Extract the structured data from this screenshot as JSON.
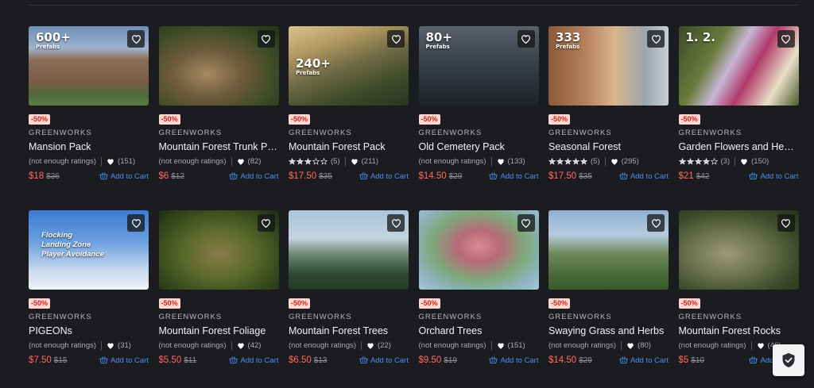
{
  "colors": {
    "background": "#1b1c20",
    "discount_bg": "#ffd8d4",
    "discount_text": "#c8261a",
    "sale_price": "#ff6b5e",
    "link": "#4a8ff3"
  },
  "products": [
    {
      "discount": "-50%",
      "publisher": "GREENWORKS",
      "title": "Mansion Pack",
      "rating_text": "(not enough ratings)",
      "stars": 0,
      "favorites": "(151)",
      "price": "$18",
      "old_price": "$36",
      "cart_label": "Add to Cart",
      "overlay_big": "600+",
      "overlay_small": "Prefabs",
      "thumb_bg": "linear-gradient(180deg,#6e8fb8 0%,#9fb3cf 28%,#8a6e58 42%,#7a5c47 70%,#4f6a3c 86%,#5c7a45 100%)"
    },
    {
      "discount": "-50%",
      "publisher": "GREENWORKS",
      "title": "Mountain Forest Trunk Pack",
      "rating_text": "(not enough ratings)",
      "stars": 0,
      "favorites": "(82)",
      "price": "$6",
      "old_price": "$12",
      "cart_label": "Add to Cart",
      "overlay_big": "",
      "overlay_small": "",
      "thumb_bg": "radial-gradient(ellipse at 40% 60%,#a58a63 0%,#6e5a3b 35%,#3b4a26 70%,#243018 100%)"
    },
    {
      "discount": "-50%",
      "publisher": "GREENWORKS",
      "title": "Mountain Forest Pack",
      "rating_text": "(5)",
      "stars": 3,
      "favorites": "(211)",
      "price": "$17.50",
      "old_price": "$35",
      "cart_label": "Add to Cart",
      "overlay_big": "240+",
      "overlay_small": "Prefabs",
      "thumb_bg": "linear-gradient(160deg,#d9c48e 0%,#b49a62 25%,#6f6a45 50%,#3e4a2a 75%,#2b3520 100%)"
    },
    {
      "discount": "-50%",
      "publisher": "GREENWORKS",
      "title": "Old Cemetery Pack",
      "rating_text": "(not enough ratings)",
      "stars": 0,
      "favorites": "(133)",
      "price": "$14.50",
      "old_price": "$29",
      "cart_label": "Add to Cart",
      "overlay_big": "80+",
      "overlay_small": "Prefabs",
      "thumb_bg": "linear-gradient(180deg,#59616b 0%,#3d444c 40%,#2c3238 70%,#1f2428 100%)"
    },
    {
      "discount": "-50%",
      "publisher": "GREENWORKS",
      "title": "Seasonal Forest",
      "rating_text": "(5)",
      "stars": 5,
      "favorites": "(295)",
      "price": "$17.50",
      "old_price": "$35",
      "cart_label": "Add to Cart",
      "overlay_big": "333",
      "overlay_small": "Prefabs",
      "thumb_bg": "linear-gradient(90deg,#8a5a3a 0%,#b5805a 30%,#d9b48c 55%,#9aa6ab 80%,#c8d0d4 100%)"
    },
    {
      "discount": "-50%",
      "publisher": "GREENWORKS",
      "title": "Garden Flowers and Hedges",
      "rating_text": "(3)",
      "stars": 4,
      "favorites": "(150)",
      "price": "$21",
      "old_price": "$42",
      "cart_label": "Add to Cart",
      "overlay_big": "1.       2.",
      "overlay_small": "",
      "thumb_bg": "linear-gradient(120deg,#3a4a2a 0%,#6a7a3c 30%,#c7b6d6 45%,#b03a6a 60%,#e8e0c8 80%,#4a5a2a 100%)"
    },
    {
      "discount": "-50%",
      "publisher": "GREENWORKS",
      "title": "PIGEONs",
      "rating_text": "(not enough ratings)",
      "stars": 0,
      "favorites": "(31)",
      "price": "$7.50",
      "old_price": "$15",
      "cart_label": "Add to Cart",
      "overlay_big": "",
      "overlay_small": "",
      "overlay_lines": [
        "Flocking",
        "Landing Zone",
        "Player Avoidance"
      ],
      "thumb_bg": "linear-gradient(180deg,#3b7bd2 0%,#6ca0e0 40%,#c6d8ee 75%,#eef2f6 100%)"
    },
    {
      "discount": "-50%",
      "publisher": "GREENWORKS",
      "title": "Mountain Forest Foliage",
      "rating_text": "(not enough ratings)",
      "stars": 0,
      "favorites": "(42)",
      "price": "$5.50",
      "old_price": "$11",
      "cart_label": "Add to Cart",
      "overlay_big": "",
      "overlay_small": "",
      "thumb_bg": "radial-gradient(ellipse at 50% 55%,#8a7a4a 0%,#5d6a2c 40%,#34481c 75%,#1f2c12 100%)"
    },
    {
      "discount": "-50%",
      "publisher": "GREENWORKS",
      "title": "Mountain Forest Trees",
      "rating_text": "(not enough ratings)",
      "stars": 0,
      "favorites": "(22)",
      "price": "$6.50",
      "old_price": "$13",
      "cart_label": "Add to Cart",
      "overlay_big": "",
      "overlay_small": "",
      "thumb_bg": "linear-gradient(180deg,#a9c4dc 0%,#c4d4e2 35%,#6f8a76 55%,#2f4a32 80%,#233a26 100%)"
    },
    {
      "discount": "-50%",
      "publisher": "GREENWORKS",
      "title": "Orchard Trees",
      "rating_text": "(not enough ratings)",
      "stars": 0,
      "favorites": "(151)",
      "price": "$9.50",
      "old_price": "$19",
      "cart_label": "Add to Cart",
      "overlay_big": "",
      "overlay_small": "",
      "thumb_bg": "radial-gradient(ellipse at 50% 45%,#d98a94 0%,#b86a78 25%,#7ea87a 55%,#8fb4c2 80%,#a6c6d4 100%)"
    },
    {
      "discount": "-50%",
      "publisher": "GREENWORKS",
      "title": "Swaying Grass and Herbs",
      "rating_text": "(not enough ratings)",
      "stars": 0,
      "favorites": "(80)",
      "price": "$14.50",
      "old_price": "$29",
      "cart_label": "Add to Cart",
      "overlay_big": "",
      "overlay_small": "",
      "thumb_bg": "linear-gradient(180deg,#8fb0d2 0%,#b6cbe0 30%,#6e8a5a 55%,#4a6a3a 80%,#3a5a2c 100%)"
    },
    {
      "discount": "-50%",
      "publisher": "GREENWORKS",
      "title": "Mountain Forest Rocks",
      "rating_text": "(not enough ratings)",
      "stars": 0,
      "favorites": "(46)",
      "price": "$5",
      "old_price": "$10",
      "cart_label": "Add to Cart",
      "overlay_big": "",
      "overlay_small": "",
      "thumb_bg": "radial-gradient(ellipse at 40% 55%,#9a9a7a 0%,#6f7452 35%,#3d4a2a 70%,#28331c 100%)"
    }
  ]
}
